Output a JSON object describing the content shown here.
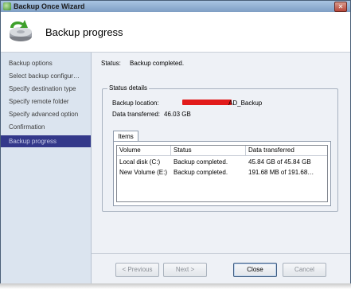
{
  "window": {
    "title": "Backup Once Wizard",
    "close_glyph": "✕"
  },
  "header": {
    "title": "Backup progress",
    "icon": "backup-drive-icon"
  },
  "sidebar": {
    "items": [
      {
        "label": "Backup options",
        "active": false
      },
      {
        "label": "Select backup configur…",
        "active": false
      },
      {
        "label": "Specify destination type",
        "active": false
      },
      {
        "label": "Specify remote folder",
        "active": false
      },
      {
        "label": "Specify advanced option",
        "active": false
      },
      {
        "label": "Confirmation",
        "active": false
      },
      {
        "label": "Backup progress",
        "active": true
      }
    ]
  },
  "status": {
    "label": "Status:",
    "value": "Backup completed."
  },
  "details": {
    "group_title": "Status details",
    "location_label": "Backup location:",
    "location_suffix": "AD_Backup",
    "transferred_label": "Data transferred:",
    "transferred_value": "46.03 GB",
    "tab_label": "Items",
    "columns": [
      "Volume",
      "Status",
      "Data transferred"
    ],
    "rows": [
      {
        "volume": "Local disk (C:)",
        "status": "Backup completed.",
        "transferred": "45.84 GB of 45.84 GB"
      },
      {
        "volume": "New Volume (E:)",
        "status": "Backup completed.",
        "transferred": "191.68 MB of 191.68…"
      }
    ]
  },
  "footer": {
    "previous": "< Previous",
    "next": "Next >",
    "close": "Close",
    "cancel": "Cancel"
  },
  "colors": {
    "active_nav_bg": "#33388a",
    "redaction": "#e21b1b"
  }
}
